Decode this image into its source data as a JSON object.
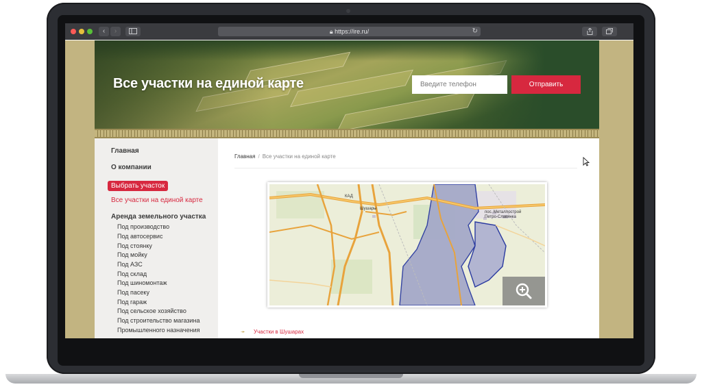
{
  "browser": {
    "url": "https://ire.ru/",
    "back_icon": "‹",
    "forward_icon": "›"
  },
  "hero": {
    "title": "Все участки на единой карте",
    "phone_placeholder": "Введите телефон",
    "submit_label": "Отправить"
  },
  "sidebar": {
    "items": [
      {
        "label": "Главная"
      },
      {
        "label": "О компании"
      },
      {
        "label": "Выбрать участок"
      },
      {
        "label": "Все участки на единой карте"
      },
      {
        "label": "Аренда земельного участка"
      }
    ],
    "subitems": [
      "Под производство",
      "Под автосервис",
      "Под стоянку",
      "Под мойку",
      "Под АЗС",
      "Под склад",
      "Под шиномонтаж",
      "Под пасеку",
      "Под гараж",
      "Под сельское хозяйство",
      "Под строительство магазина",
      "Промышленного назначения"
    ]
  },
  "content": {
    "breadcrumb_home": "Главная",
    "breadcrumb_separator": "/",
    "breadcrumb_current": "Все участки на единой карте",
    "map_labels": {
      "town": "Шушары",
      "settlement_1": "пос. Металлострой",
      "settlement_2": "Петро-Славянка",
      "road": "КАД"
    },
    "bottom_arrow": "➛",
    "bottom_link": "Участки в Шушарах"
  },
  "colors": {
    "accent": "#d7283f",
    "page_bg": "#c2b481"
  }
}
